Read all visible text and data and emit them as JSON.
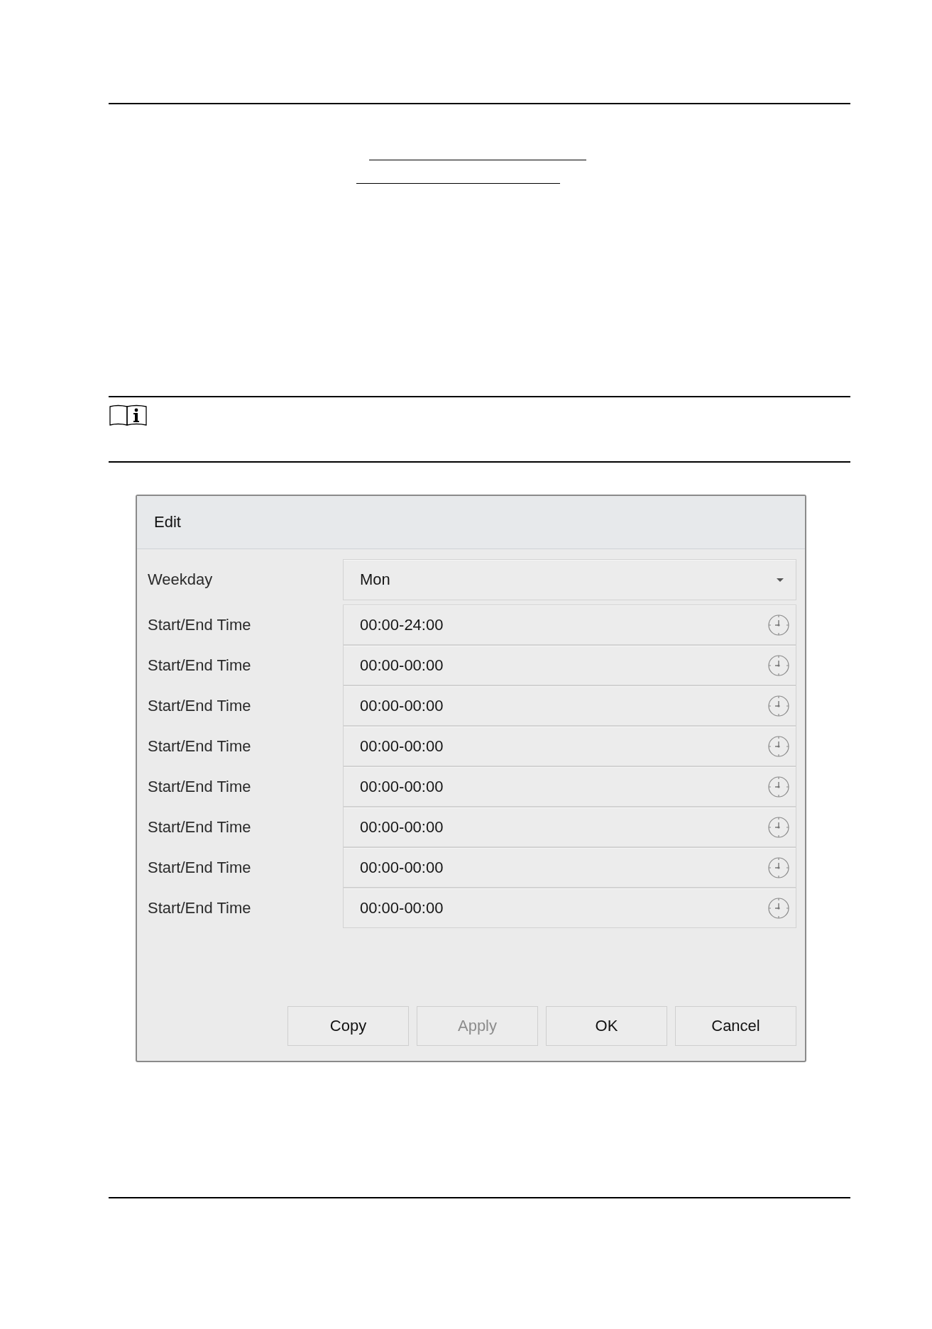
{
  "dialog": {
    "title": "Edit",
    "fields": [
      {
        "kind": "dropdown",
        "label": "Weekday",
        "value": "Mon"
      },
      {
        "kind": "time",
        "label": "Start/End Time",
        "value": "00:00-24:00"
      },
      {
        "kind": "time",
        "label": "Start/End Time",
        "value": "00:00-00:00"
      },
      {
        "kind": "time",
        "label": "Start/End Time",
        "value": "00:00-00:00"
      },
      {
        "kind": "time",
        "label": "Start/End Time",
        "value": "00:00-00:00"
      },
      {
        "kind": "time",
        "label": "Start/End Time",
        "value": "00:00-00:00"
      },
      {
        "kind": "time",
        "label": "Start/End Time",
        "value": "00:00-00:00"
      },
      {
        "kind": "time",
        "label": "Start/End Time",
        "value": "00:00-00:00"
      },
      {
        "kind": "time",
        "label": "Start/End Time",
        "value": "00:00-00:00"
      }
    ],
    "buttons": [
      {
        "label": "Copy",
        "disabled": false
      },
      {
        "label": "Apply",
        "disabled": true
      },
      {
        "label": "OK",
        "disabled": false
      },
      {
        "label": "Cancel",
        "disabled": false
      }
    ]
  }
}
